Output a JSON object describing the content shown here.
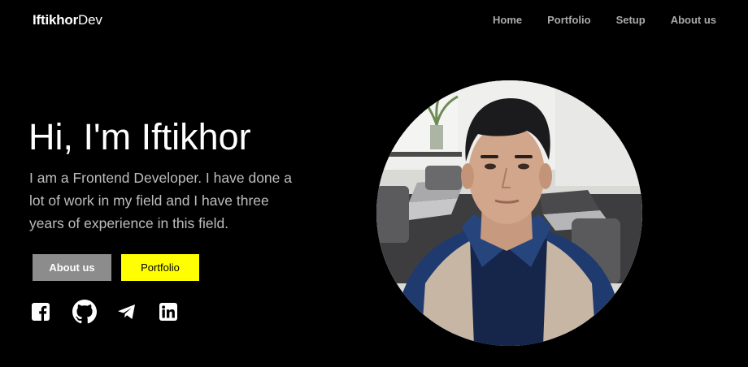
{
  "header": {
    "logo_bold": "Iftikhor",
    "logo_light": "Dev",
    "nav": [
      "Home",
      "Portfolio",
      "Setup",
      "About us"
    ]
  },
  "hero": {
    "title": "Hi, I'm Iftikhor",
    "description": "I am a Frontend Developer. I have done a lot of work in my field and I have three years of experience in this field.",
    "buttons": {
      "about": "About us",
      "portfolio": "Portfolio"
    },
    "socials": [
      "facebook-icon",
      "github-icon",
      "telegram-icon",
      "linkedin-icon"
    ]
  },
  "colors": {
    "background": "#000000",
    "accent": "#ffff00",
    "secondary_button": "#8c8c8c",
    "nav_text": "#aaaaaa",
    "body_text": "#bdbdbd"
  }
}
